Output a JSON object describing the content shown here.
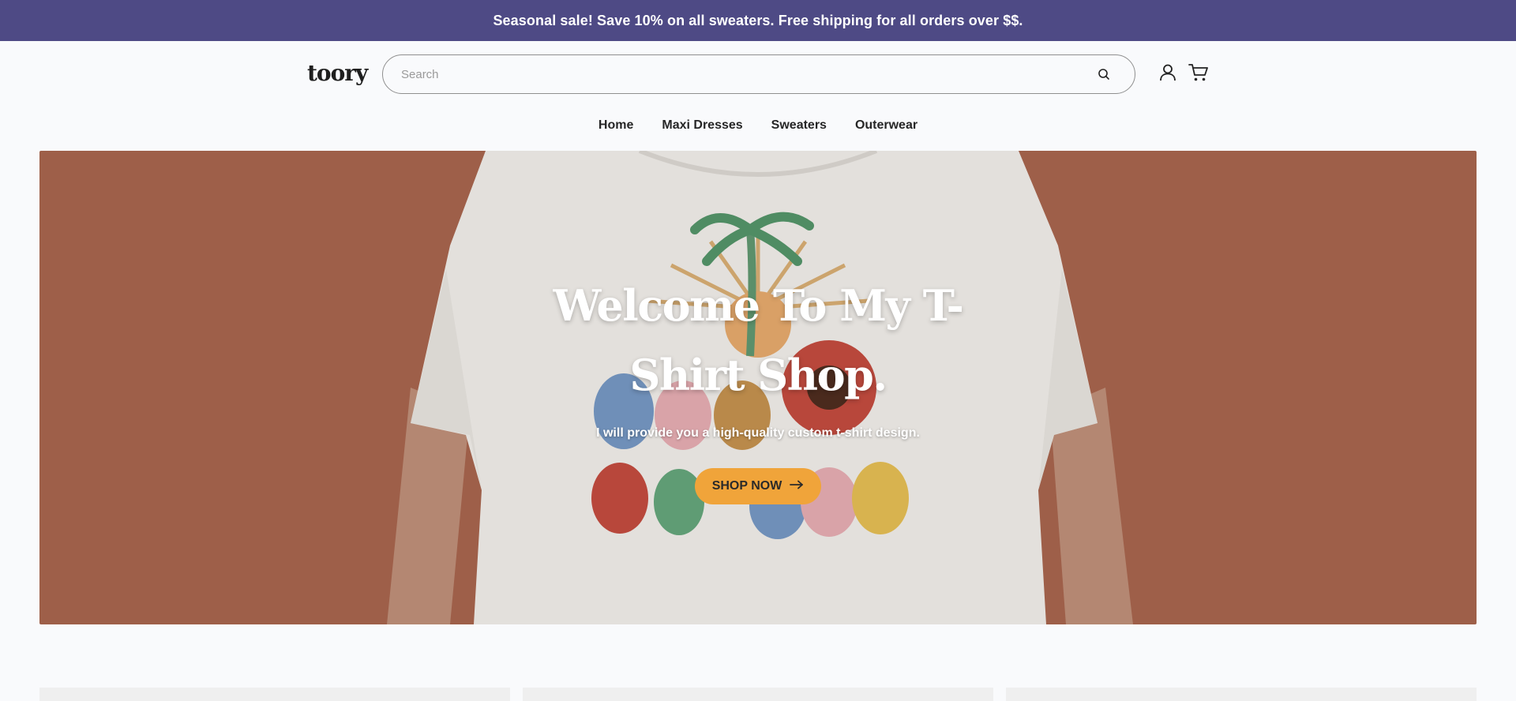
{
  "announcement": "Seasonal sale! Save 10% on all sweaters. Free shipping for all orders over $$.",
  "header": {
    "logo": "toory",
    "search_placeholder": "Search",
    "icons": [
      "search-icon",
      "account-icon",
      "cart-icon"
    ]
  },
  "nav": {
    "items": [
      {
        "label": "Home"
      },
      {
        "label": "Maxi Dresses"
      },
      {
        "label": "Sweaters"
      },
      {
        "label": "Outerwear"
      }
    ]
  },
  "hero": {
    "title": "Welcome To My T-Shirt Shop.",
    "subtitle": "I will provide you a high-quality custom t-shirt design.",
    "cta_label": "SHOP NOW",
    "cta_icon": "arrow-right-icon"
  },
  "colors": {
    "announcement_bg": "#4e4a85",
    "hero_bg": "#9e5f49",
    "cta_bg": "#f0a43a",
    "page_bg": "#f9fafc"
  }
}
